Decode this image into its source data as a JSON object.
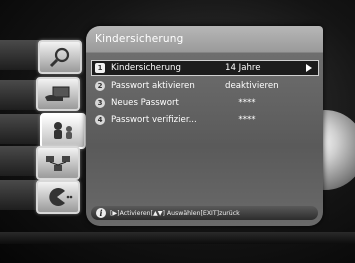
{
  "panel": {
    "title": "Kindersicherung"
  },
  "menu": {
    "items": [
      {
        "num": "1",
        "label": "Kindersicherung",
        "value": "14 Jahre"
      },
      {
        "num": "2",
        "label": "Passwort aktivieren",
        "value": "deaktivieren"
      },
      {
        "num": "3",
        "label": "Neues Passwort",
        "value": "****"
      },
      {
        "num": "4",
        "label": "Passwort verifizier...",
        "value": "****"
      }
    ]
  },
  "help": {
    "info_icon": "i",
    "text": "[▶]Activieren[▲▼] Auswählen[EXIT]zurück"
  },
  "side_icons": [
    "search-icon",
    "hand-card-icon",
    "parental-lock-icon",
    "network-icon",
    "pacman-icon"
  ]
}
